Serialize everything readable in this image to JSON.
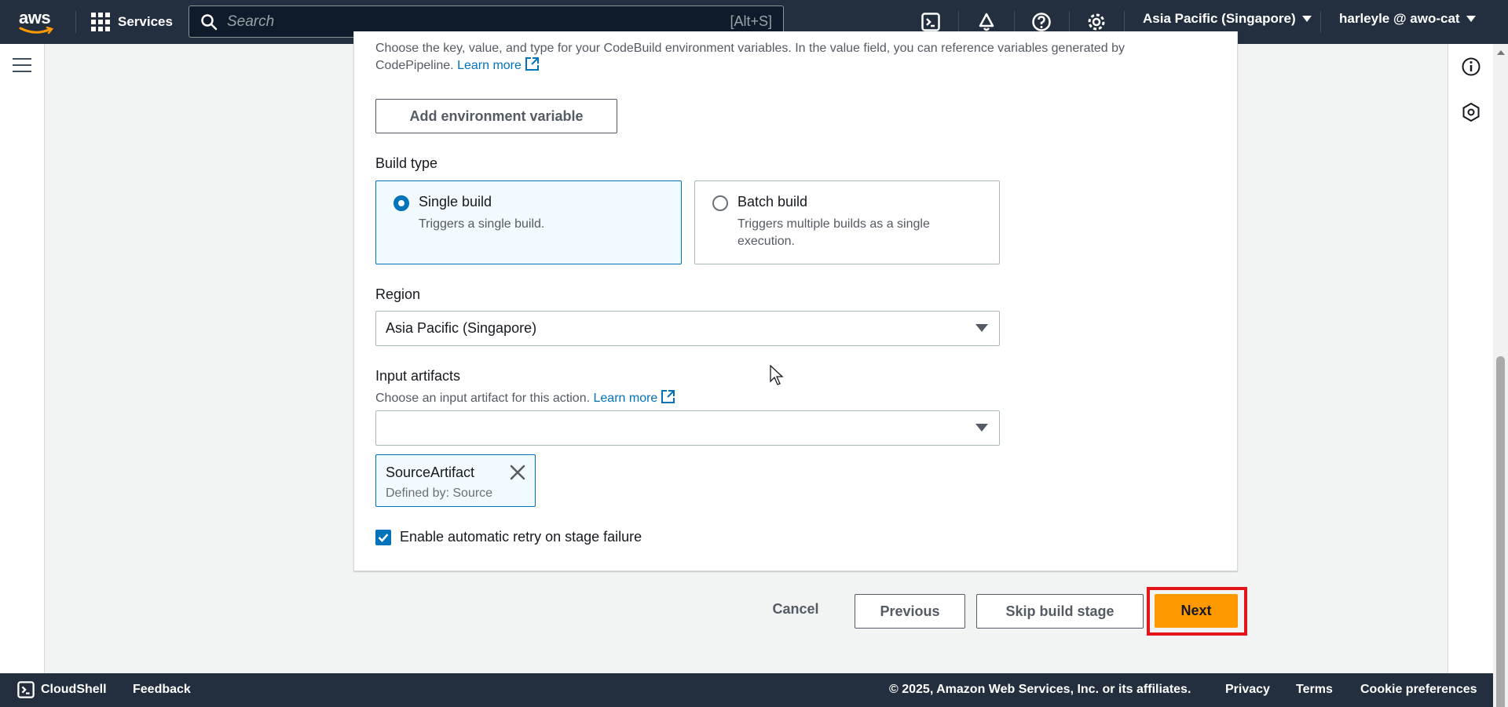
{
  "topnav": {
    "logo_text": "aws",
    "services_label": "Services",
    "search_placeholder": "Search",
    "search_shortcut": "[Alt+S]",
    "region_label": "Asia Pacific (Singapore)",
    "user_label": "harleyle @ awo-cat",
    "icons": [
      "cloudshell-icon",
      "notifications-bell-icon",
      "help-icon",
      "settings-gear-icon"
    ]
  },
  "panel": {
    "env_description": "Choose the key, value, and type for your CodeBuild environment variables. In the value field, you can reference variables generated by CodePipeline.",
    "learn_more_1": "Learn more",
    "add_env_button": "Add environment variable",
    "build_type_label": "Build type",
    "build_types": [
      {
        "title": "Single build",
        "description": "Triggers a single build.",
        "selected": true
      },
      {
        "title": "Batch build",
        "description": "Triggers multiple builds as a single execution.",
        "selected": false
      }
    ],
    "region_label": "Region",
    "region_value": "Asia Pacific (Singapore)",
    "input_artifacts_label": "Input artifacts",
    "input_artifacts_description": "Choose an input artifact for this action.",
    "learn_more_2": "Learn more",
    "input_artifacts_value": "",
    "token": {
      "name": "SourceArtifact",
      "defined_by": "Defined by: Source"
    },
    "retry_checkbox": {
      "label": "Enable automatic retry on stage failure",
      "checked": true
    }
  },
  "actions": {
    "cancel": "Cancel",
    "previous": "Previous",
    "skip": "Skip build stage",
    "next": "Next"
  },
  "footer": {
    "cloudshell": "CloudShell",
    "feedback": "Feedback",
    "copyright": "© 2025, Amazon Web Services, Inc. or its affiliates.",
    "privacy": "Privacy",
    "terms": "Terms",
    "cookies": "Cookie preferences"
  },
  "colors": {
    "nav_bg": "#232f3e",
    "primary": "#ff9900",
    "link": "#0073bb",
    "highlight_box": "#e4141b"
  }
}
